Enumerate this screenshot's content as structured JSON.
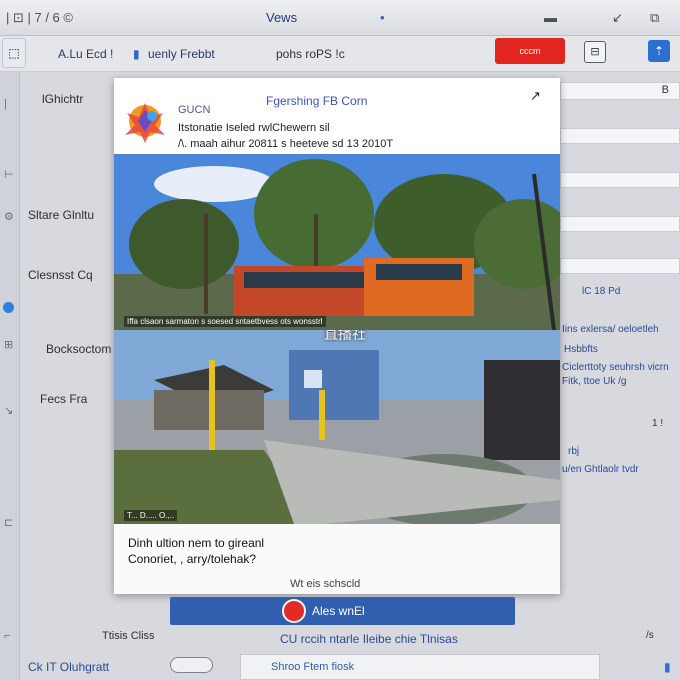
{
  "os_bar": {
    "left_text": "| ⊡ | 7 / 6 ©",
    "center_text": "Vews",
    "right_icon": "battery-icon"
  },
  "toolbar": {
    "tab_left": "A.Lu Ecd !",
    "tab_app": "uenly Frebbt",
    "mid_text": "pohs roPS !c",
    "red_button": "cccm ",
    "sq_button": "⊟"
  },
  "sidebar": {
    "labels": [
      "lGhichtr",
      "Sltare  Glnltu",
      "Clesnsst  Cq",
      "Bocksoctom",
      "Fecs  Fra"
    ],
    "bottom": [
      "Ttisis  Cliss",
      "Ck  IT  Oluhgratt"
    ]
  },
  "popup": {
    "header_small": "GUCN",
    "header_title": "Fgershing FB Corn",
    "header_line1": "Itstonatie Iseled rwlChewern sil",
    "header_line2": "/\\.  maah aihur 20811 s heeteve sd 13 2010T",
    "photo1_caption": "Iffa  clsaon sarmaton s  soesed sntaetbvess ots  wonsstrl",
    "photo_overlay_cn": "直播社",
    "photo2_caption": "T... D..... O.,..",
    "body_line1": "Dinh ultion nem to gireanl",
    "body_line2": "Conoriet, , arry/tolehak?",
    "footer": "Wt eis schscld"
  },
  "right_panel": {
    "rows": [
      "lC 18 Pd",
      "Iins exlersa/ oeloetleh",
      "Hsbbfts",
      "Ciclerttoty seuhrsh vicrn",
      "Fitk, ttoe Uk /g",
      "1 !",
      "rbj",
      "u/en  Ghtlaolr tvdr",
      "/s"
    ]
  },
  "action": {
    "label": "Ales wnEl"
  },
  "bottom": {
    "links": "CU rccih ntarle Ileibe chie Tlnisas",
    "bar_label": "Shroo Ftem fiosk"
  }
}
